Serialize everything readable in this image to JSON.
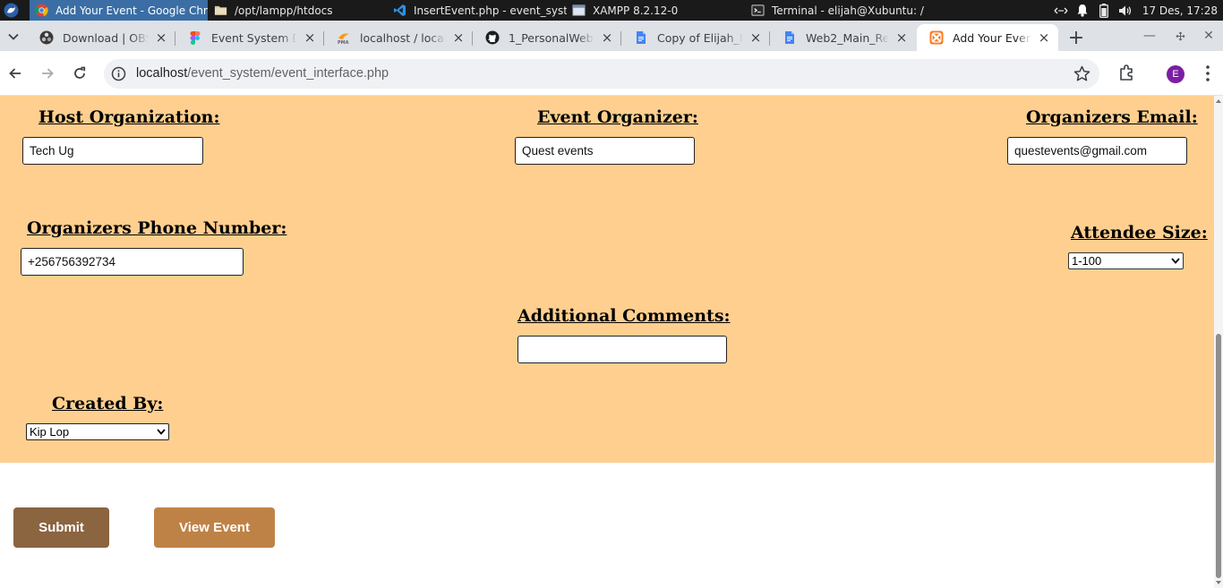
{
  "taskbar": {
    "tasks": [
      {
        "label": "Add Your Event - Google Chr...",
        "icon": "chrome-icon"
      },
      {
        "label": "/opt/lampp/htdocs",
        "icon": "folder-icon"
      },
      {
        "label": "InsertEvent.php - event_syst...",
        "icon": "vscode-icon"
      },
      {
        "label": "XAMPP 8.2.12-0",
        "icon": "window-icon"
      },
      {
        "label": "Terminal - elijah@Xubuntu: /...",
        "icon": "terminal-icon"
      }
    ],
    "clock": "17 Des, 17:28"
  },
  "browser": {
    "tabs": [
      {
        "label": "Download | OBS",
        "icon": "obs-icon"
      },
      {
        "label": "Event System De",
        "icon": "figma-icon"
      },
      {
        "label": "localhost / localh",
        "icon": "phpmyadmin-icon"
      },
      {
        "label": "1_PersonalWebs",
        "icon": "github-icon"
      },
      {
        "label": "Copy of Elijah_Fi",
        "icon": "google-docs-icon"
      },
      {
        "label": "Web2_Main_Rep",
        "icon": "google-docs-icon"
      },
      {
        "label": "Add Your Event",
        "icon": "xampp-icon"
      }
    ],
    "url_host": "localhost",
    "url_path": "/event_system/event_interface.php",
    "profile_initial": "E"
  },
  "form": {
    "host_org": {
      "label": "Host Organization:",
      "value": "Tech Ug"
    },
    "event_organizer": {
      "label": "Event Organizer:",
      "value": "Quest events"
    },
    "organizer_email": {
      "label": "Organizers Email:",
      "value": "questevents@gmail.com"
    },
    "organizer_phone": {
      "label": "Organizers Phone Number:",
      "value": "+256756392734"
    },
    "attendee_size": {
      "label": "Attendee Size:",
      "value": "1-100"
    },
    "comments": {
      "label": "Additional Comments:",
      "value": ""
    },
    "created_by": {
      "label": "Created By:",
      "value": "Kip Lop"
    }
  },
  "actions": {
    "submit": "Submit",
    "view_event": "View Event"
  },
  "colors": {
    "form_background": "#ffcf8f",
    "submit_button": "#8b6440",
    "view_button": "#bf8246"
  }
}
